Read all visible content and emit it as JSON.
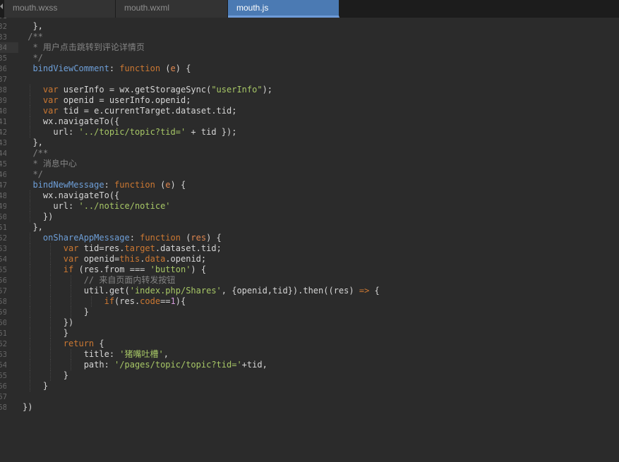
{
  "tabs": [
    {
      "label": "mouth.wxss",
      "active": false
    },
    {
      "label": "mouth.wxml",
      "active": false
    },
    {
      "label": "mouth.js",
      "active": true
    }
  ],
  "editor": {
    "current_line": 34,
    "lines": [
      {
        "num": "31",
        "tokens": []
      },
      {
        "num": "32",
        "tokens": [
          [
            "plain",
            "  },"
          ]
        ]
      },
      {
        "num": "33",
        "tokens": [
          [
            "cmt",
            " /**"
          ]
        ]
      },
      {
        "num": "34",
        "tokens": [
          [
            "cmt",
            "  * 用户点击跳转到评论详情页"
          ]
        ]
      },
      {
        "num": "35",
        "tokens": [
          [
            "cmt",
            "  */"
          ]
        ]
      },
      {
        "num": "36",
        "tokens": [
          [
            "prop",
            "  bindViewComment"
          ],
          [
            "plain",
            ": "
          ],
          [
            "kw",
            "function"
          ],
          [
            "plain",
            " ("
          ],
          [
            "param",
            "e"
          ],
          [
            "plain",
            ") {"
          ]
        ]
      },
      {
        "num": "37",
        "tokens": []
      },
      {
        "num": "38",
        "tokens": [
          [
            "kw",
            "    var"
          ],
          [
            "plain",
            " userInfo = wx.getStorageSync("
          ],
          [
            "str",
            "\"userInfo\""
          ],
          [
            "plain",
            ");"
          ]
        ]
      },
      {
        "num": "39",
        "tokens": [
          [
            "kw",
            "    var"
          ],
          [
            "plain",
            " openid = userInfo.openid;"
          ]
        ]
      },
      {
        "num": "40",
        "tokens": [
          [
            "kw",
            "    var"
          ],
          [
            "plain",
            " tid = e.currentTarget.dataset.tid;"
          ]
        ]
      },
      {
        "num": "41",
        "tokens": [
          [
            "plain",
            "    wx.navigateTo({"
          ]
        ]
      },
      {
        "num": "42",
        "tokens": [
          [
            "plain",
            "      url: "
          ],
          [
            "str",
            "'../topic/topic?tid='"
          ],
          [
            "plain",
            " + tid });"
          ]
        ]
      },
      {
        "num": "43",
        "tokens": [
          [
            "plain",
            "  },"
          ]
        ]
      },
      {
        "num": "44",
        "tokens": [
          [
            "cmt",
            "  /**"
          ]
        ]
      },
      {
        "num": "45",
        "tokens": [
          [
            "cmt",
            "  * 消息中心"
          ]
        ]
      },
      {
        "num": "46",
        "tokens": [
          [
            "cmt",
            "  */"
          ]
        ]
      },
      {
        "num": "47",
        "tokens": [
          [
            "prop",
            "  bindNewMessage"
          ],
          [
            "plain",
            ": "
          ],
          [
            "kw",
            "function"
          ],
          [
            "plain",
            " ("
          ],
          [
            "param",
            "e"
          ],
          [
            "plain",
            ") {"
          ]
        ]
      },
      {
        "num": "48",
        "tokens": [
          [
            "plain",
            "    wx.navigateTo({"
          ]
        ]
      },
      {
        "num": "49",
        "tokens": [
          [
            "plain",
            "      url: "
          ],
          [
            "str",
            "'../notice/notice'"
          ]
        ]
      },
      {
        "num": "50",
        "tokens": [
          [
            "plain",
            "    })"
          ]
        ]
      },
      {
        "num": "51",
        "tokens": [
          [
            "plain",
            "  },"
          ]
        ]
      },
      {
        "num": "52",
        "tokens": [
          [
            "prop",
            "    onShareAppMessage"
          ],
          [
            "plain",
            ": "
          ],
          [
            "kw",
            "function"
          ],
          [
            "plain",
            " ("
          ],
          [
            "param",
            "res"
          ],
          [
            "plain",
            ") {"
          ]
        ]
      },
      {
        "num": "53",
        "tokens": [
          [
            "kw",
            "        var"
          ],
          [
            "plain",
            " tid=res."
          ],
          [
            "kw",
            "target"
          ],
          [
            "plain",
            ".dataset.tid;"
          ]
        ]
      },
      {
        "num": "54",
        "tokens": [
          [
            "kw",
            "        var"
          ],
          [
            "plain",
            " openid="
          ],
          [
            "this",
            "this"
          ],
          [
            "plain",
            "."
          ],
          [
            "kw",
            "data"
          ],
          [
            "plain",
            ".openid;"
          ]
        ]
      },
      {
        "num": "55",
        "tokens": [
          [
            "kw",
            "        if"
          ],
          [
            "plain",
            " (res.from === "
          ],
          [
            "str",
            "'button'"
          ],
          [
            "plain",
            ") {"
          ]
        ]
      },
      {
        "num": "56",
        "tokens": [
          [
            "cmt",
            "            // 来自页面内转发按钮"
          ]
        ]
      },
      {
        "num": "57",
        "tokens": [
          [
            "plain",
            "            util.get("
          ],
          [
            "str",
            "'index.php/Shares'"
          ],
          [
            "plain",
            ", {openid,tid}).then((res) "
          ],
          [
            "kw",
            "=>"
          ],
          [
            "plain",
            " {"
          ]
        ]
      },
      {
        "num": "58",
        "tokens": [
          [
            "kw",
            "                if"
          ],
          [
            "plain",
            "(res."
          ],
          [
            "kw",
            "code"
          ],
          [
            "plain",
            "=="
          ],
          [
            "num",
            "1"
          ],
          [
            "plain",
            "){"
          ]
        ]
      },
      {
        "num": "59",
        "tokens": [
          [
            "plain",
            "            }"
          ]
        ]
      },
      {
        "num": "60",
        "tokens": [
          [
            "plain",
            "        })"
          ]
        ]
      },
      {
        "num": "61",
        "tokens": [
          [
            "plain",
            "        }"
          ]
        ]
      },
      {
        "num": "62",
        "tokens": [
          [
            "kw",
            "        return"
          ],
          [
            "plain",
            " {"
          ]
        ]
      },
      {
        "num": "63",
        "tokens": [
          [
            "plain",
            "            title: "
          ],
          [
            "str",
            "'猪嘴吐槽'"
          ],
          [
            "plain",
            ","
          ]
        ]
      },
      {
        "num": "64",
        "tokens": [
          [
            "plain",
            "            path: "
          ],
          [
            "str",
            "'/pages/topic/topic?tid='"
          ],
          [
            "plain",
            "+tid,"
          ]
        ]
      },
      {
        "num": "65",
        "tokens": [
          [
            "plain",
            "        }"
          ]
        ]
      },
      {
        "num": "66",
        "tokens": [
          [
            "plain",
            "    }"
          ]
        ]
      },
      {
        "num": "67",
        "tokens": []
      },
      {
        "num": "68",
        "tokens": [
          [
            "plain",
            "})"
          ]
        ]
      }
    ]
  },
  "colors": {
    "background": "#2b2b2b",
    "tab_active": "#4b7ab3",
    "keyword": "#cc7832",
    "string": "#a7c766",
    "comment": "#848484",
    "property": "#6e9fd8"
  }
}
